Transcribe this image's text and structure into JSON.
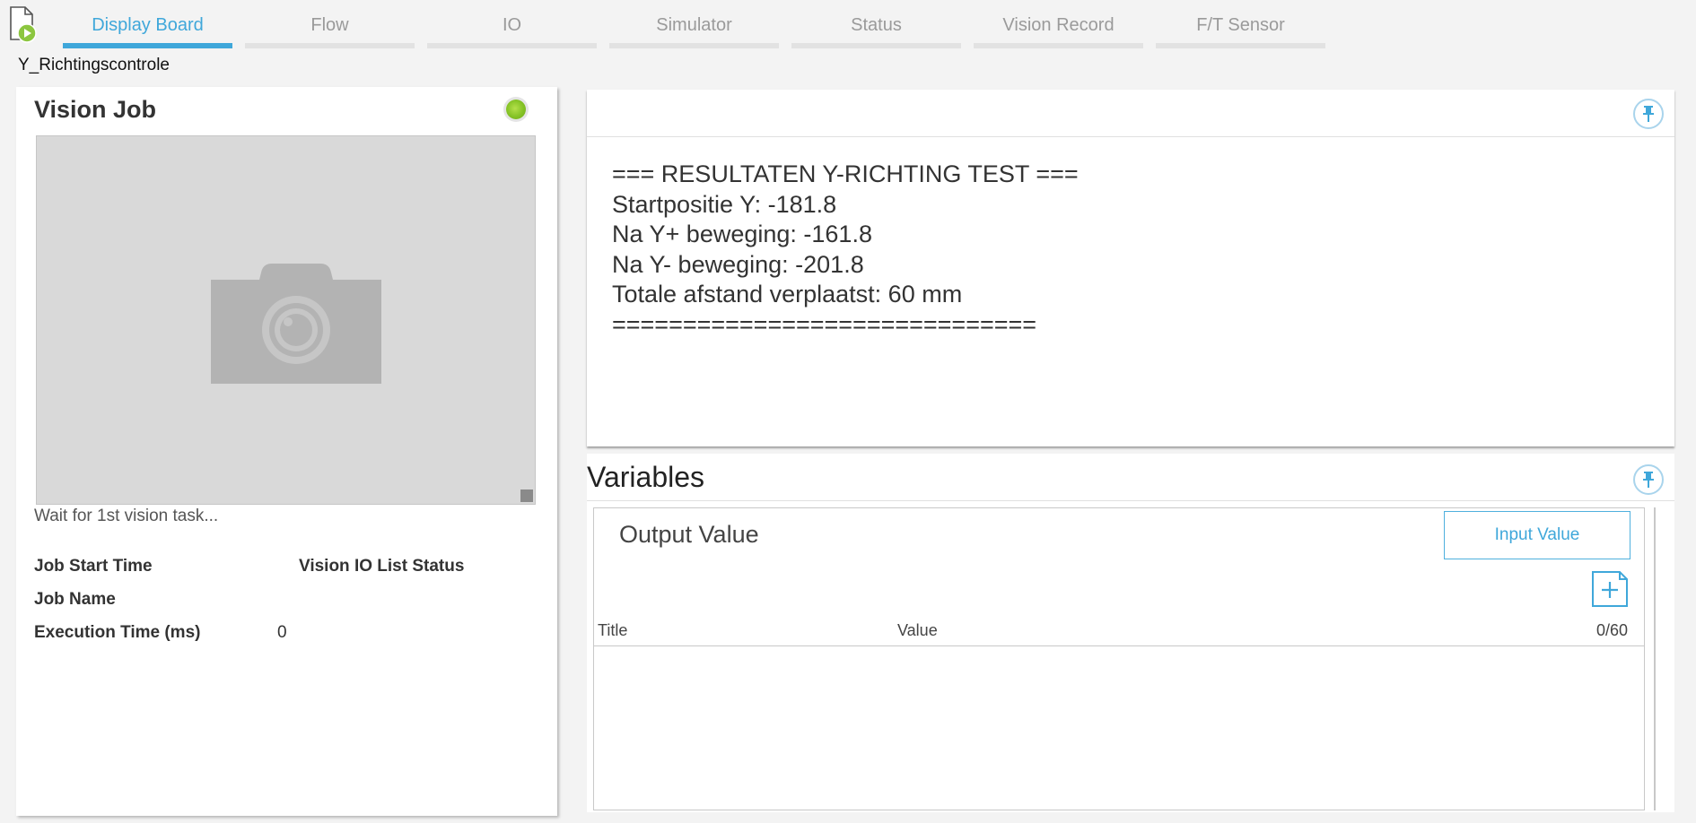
{
  "tabs": [
    {
      "label": "Display Board",
      "active": true
    },
    {
      "label": "Flow"
    },
    {
      "label": "IO"
    },
    {
      "label": "Simulator"
    },
    {
      "label": "Status"
    },
    {
      "label": "Vision Record"
    },
    {
      "label": "F/T Sensor"
    }
  ],
  "project_name": "Y_Richtingscontrole",
  "vision_job": {
    "title": "Vision Job",
    "status_color": "#84c225",
    "preview_icon": "camera-icon",
    "wait_text": "Wait for 1st vision task...",
    "job_start_time_label": "Job Start Time",
    "vision_io_list_status_label": "Vision IO List Status",
    "job_name_label": "Job Name",
    "execution_time_label": "Execution Time (ms)",
    "execution_time_value": "0"
  },
  "results": {
    "lines": [
      "=== RESULTATEN Y-RICHTING TEST ===",
      "Startpositie Y: -181.8",
      "Na Y+ beweging: -161.8",
      "Na Y- beweging: -201.8",
      "Totale afstand verplaatst: 60 mm",
      "=============================="
    ]
  },
  "variables": {
    "title": "Variables",
    "output_title": "Output Value",
    "input_value_button": "Input Value",
    "col_title": "Title",
    "col_value": "Value",
    "count": "0/60"
  },
  "colors": {
    "accent": "#3fa7da",
    "status_green": "#84c225"
  }
}
